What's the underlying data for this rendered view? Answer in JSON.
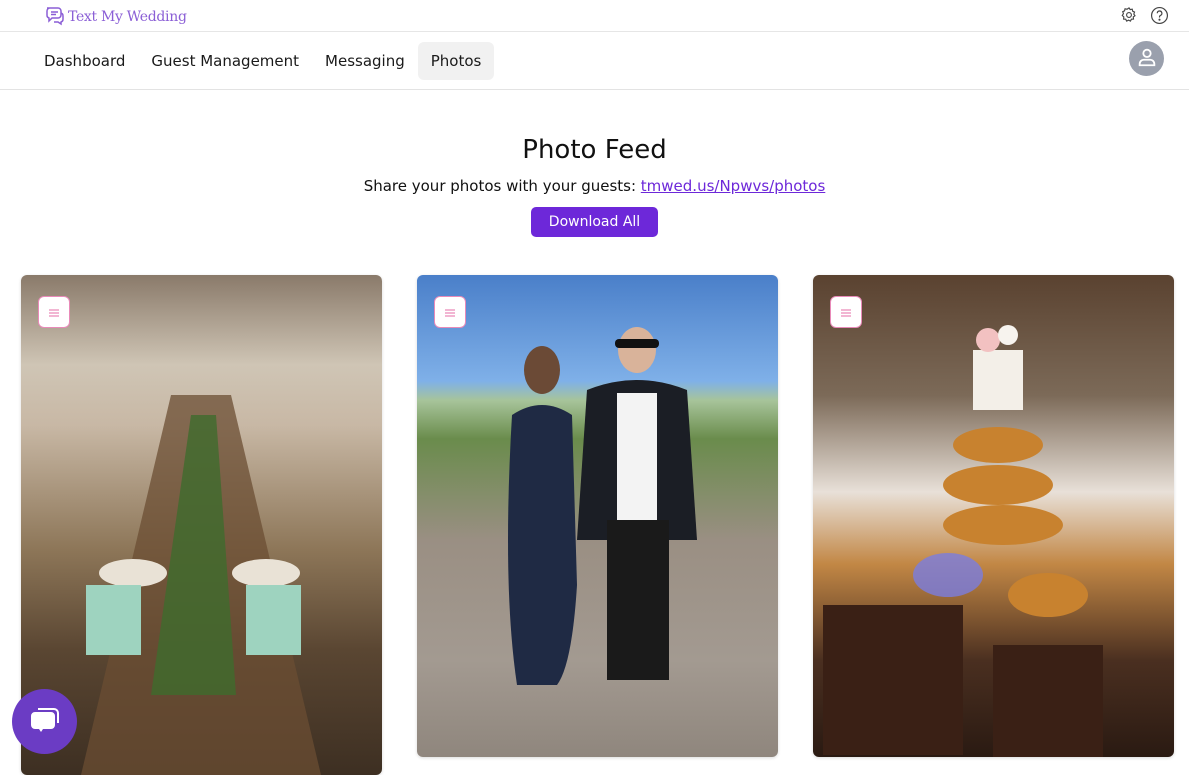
{
  "app": {
    "logo_text": "Text My Wedding",
    "brand_color": "#8b5fd6",
    "accent_color": "#6d28d9"
  },
  "topbar": {
    "icons": [
      "gear-icon",
      "help-icon"
    ]
  },
  "nav": {
    "items": [
      {
        "label": "Dashboard",
        "active": false
      },
      {
        "label": "Guest Management",
        "active": false
      },
      {
        "label": "Messaging",
        "active": false
      },
      {
        "label": "Photos",
        "active": true
      }
    ],
    "avatar_icon": "user-icon"
  },
  "main": {
    "title": "Photo Feed",
    "share_text": "Share your photos with your guests:",
    "share_link": "tmwed.us/Npwvs/photos",
    "download_all_label": "Download All"
  },
  "photos": [
    {
      "description": "Long rustic wooden table with greenery runner, mint napkins and plates under a timber pavilion",
      "menu_icon": "menu-icon"
    },
    {
      "description": "Couple posing outdoors at sunset, woman in dark dress and man in tuxedo with sunglasses",
      "menu_icon": "menu-icon"
    },
    {
      "description": "Dessert table with tiered donut stand topped by a floral cake and chocolate squares",
      "menu_icon": "menu-icon"
    }
  ],
  "chat_widget": {
    "icon": "chat-icon"
  }
}
